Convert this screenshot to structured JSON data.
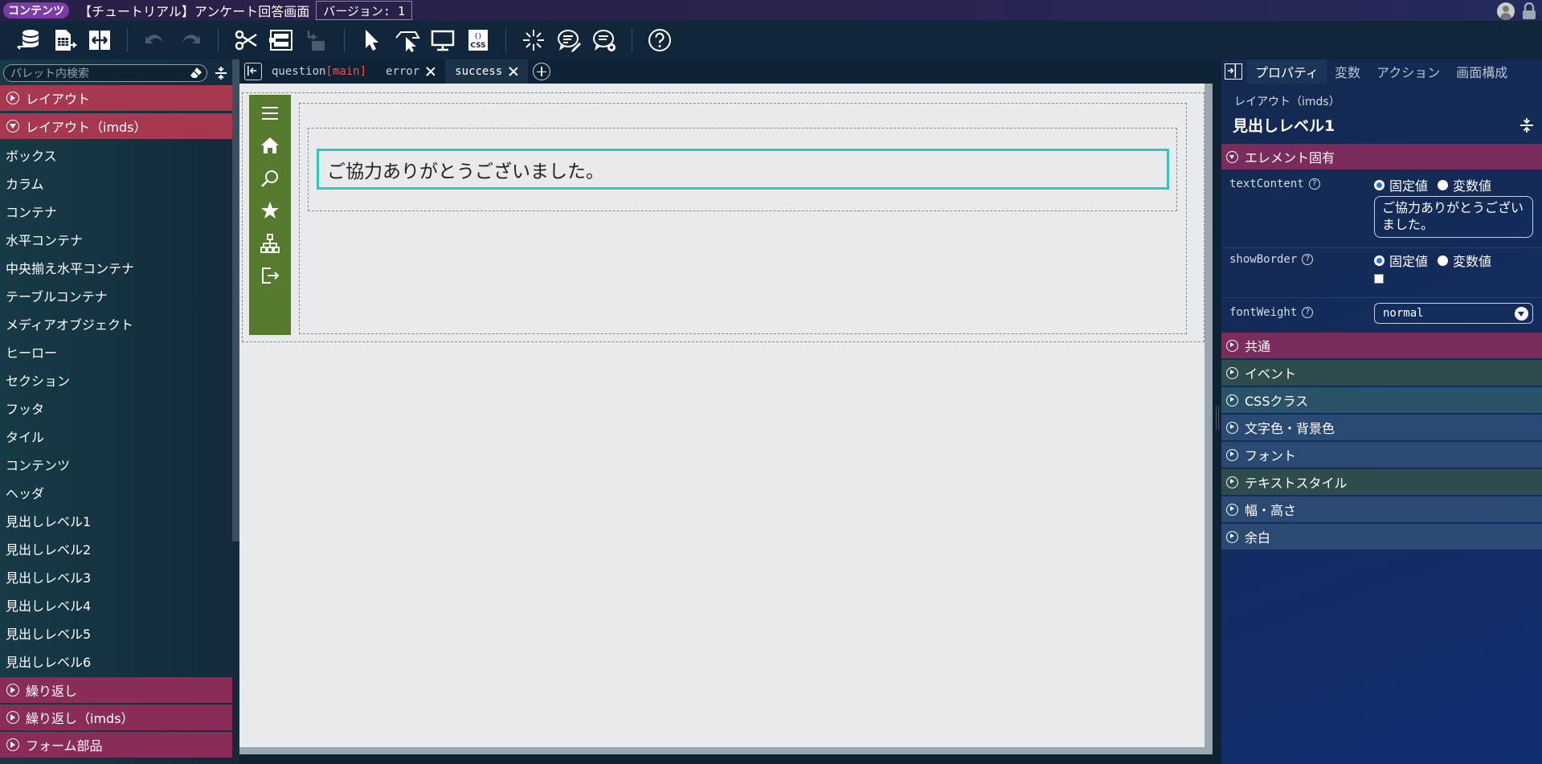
{
  "titlebar": {
    "app_badge": "コンテンツ",
    "doc_title": "【チュートリアル】アンケート回答画面",
    "version": "バージョン: 1"
  },
  "toolbar": {
    "buttons": [
      "database-sync-icon",
      "export-sheet-icon",
      "swap-icon",
      "undo-icon",
      "redo-icon",
      "cut-icon",
      "wrap-icon",
      "unwrap-icon",
      "select-pointer-icon",
      "pointer-menu-icon",
      "preview-monitor-icon",
      "css-file-icon",
      "sparkle-icon",
      "comment-edit-icon",
      "comment-settings-icon",
      "help-icon"
    ]
  },
  "palette": {
    "search_placeholder": "パレット内検索",
    "groups": [
      {
        "label": "レイアウト",
        "expanded": false
      },
      {
        "label": "レイアウト（imds）",
        "expanded": true
      }
    ],
    "items": [
      "ボックス",
      "カラム",
      "コンテナ",
      "水平コンテナ",
      "中央揃え水平コンテナ",
      "テーブルコンテナ",
      "メディアオブジェクト",
      "ヒーロー",
      "セクション",
      "フッタ",
      "タイル",
      "コンテンツ",
      "ヘッダ",
      "見出しレベル1",
      "見出しレベル2",
      "見出しレベル3",
      "見出しレベル4",
      "見出しレベル5",
      "見出しレベル6"
    ],
    "bottom_groups": [
      {
        "label": "繰り返し"
      },
      {
        "label": "繰り返し（imds）"
      },
      {
        "label": "フォーム部品"
      }
    ]
  },
  "tabs": [
    {
      "name": "question",
      "suffix": "[main]",
      "closable": false,
      "active": false
    },
    {
      "name": "error",
      "suffix": "",
      "closable": true,
      "active": false
    },
    {
      "name": "success",
      "suffix": "",
      "closable": true,
      "active": true
    }
  ],
  "canvas": {
    "heading_text": "ご協力ありがとうございました。",
    "nav_icons": [
      "menu-icon",
      "home-icon",
      "search-icon",
      "star-icon",
      "sitemap-icon",
      "logout-icon"
    ],
    "nav_color": "#567a2e",
    "selection_color": "#2ec7c0"
  },
  "right_panel": {
    "tabs": [
      "プロパティ",
      "変数",
      "アクション",
      "画面構成"
    ],
    "active_tab": "プロパティ",
    "category": "レイアウト（imds）",
    "element_name": "見出しレベル1",
    "element_section": "エレメント固有",
    "props": {
      "text_content": {
        "name": "textContent",
        "opt_fixed": "固定値",
        "opt_var": "変数値",
        "value": "ご協力ありがとうございました。"
      },
      "show_border": {
        "name": "showBorder",
        "opt_fixed": "固定値",
        "opt_var": "変数値",
        "checked": false
      },
      "font_weight": {
        "name": "fontWeight",
        "value": "normal"
      }
    },
    "sections": [
      "共通",
      "イベント",
      "CSSクラス",
      "文字色・背景色",
      "フォント",
      "テキストスタイル",
      "幅・高さ",
      "余白"
    ]
  }
}
